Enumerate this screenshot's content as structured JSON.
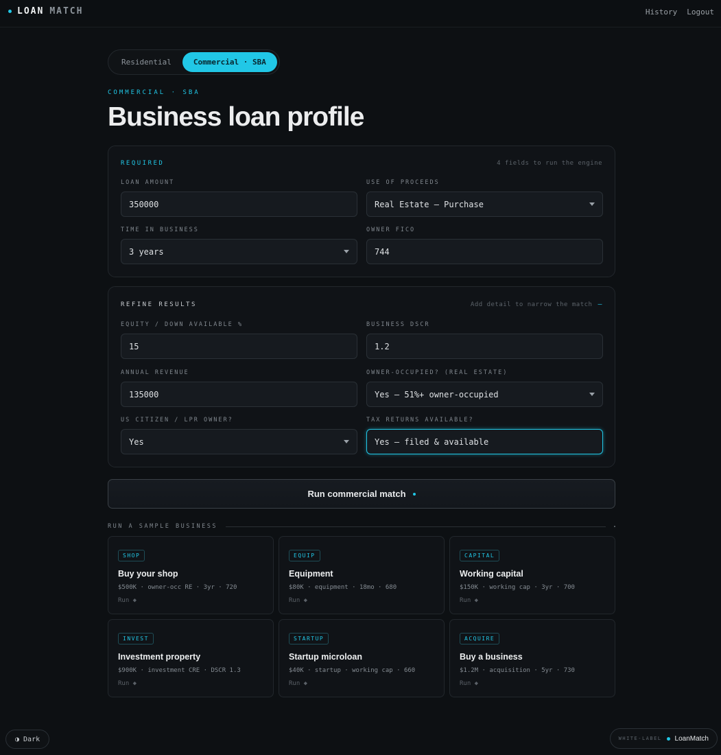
{
  "brand": {
    "loan": "LOAN",
    "match": "MATCH"
  },
  "nav": {
    "history": "History",
    "logout": "Logout"
  },
  "mode_toggle": {
    "residential": "Residential",
    "commercial": "Commercial · SBA"
  },
  "eyebrow": "COMMERCIAL · SBA",
  "title": "Business loan profile",
  "required": {
    "title": "REQUIRED",
    "hint": "4 fields to run the engine",
    "loan_amount": {
      "label": "LOAN AMOUNT",
      "value": "350000"
    },
    "use_of_proceeds": {
      "label": "USE OF PROCEEDS",
      "value": "Real Estate — Purchase"
    },
    "time_in_business": {
      "label": "TIME IN BUSINESS",
      "value": "3 years"
    },
    "owner_fico": {
      "label": "OWNER FICO",
      "value": "744"
    }
  },
  "refine": {
    "title": "REFINE RESULTS",
    "hint": "Add detail to narrow the match",
    "hint_icon": "–",
    "equity": {
      "label": "EQUITY / DOWN AVAILABLE %",
      "value": "15"
    },
    "dscr": {
      "label": "BUSINESS DSCR",
      "value": "1.2"
    },
    "annual_revenue": {
      "label": "ANNUAL REVENUE",
      "value": "135000"
    },
    "owner_occupied": {
      "label": "OWNER-OCCUPIED? (REAL ESTATE)",
      "value": "Yes — 51%+ owner-occupied"
    },
    "citizen": {
      "label": "US CITIZEN / LPR OWNER?",
      "value": "Yes"
    },
    "tax_returns": {
      "label": "TAX RETURNS AVAILABLE?",
      "value": "Yes — filed & available"
    }
  },
  "run_button": "Run commercial match",
  "samples_heading": "RUN A SAMPLE BUSINESS",
  "samples": [
    {
      "tag": "SHOP",
      "title": "Buy your shop",
      "meta": "$500K · owner-occ RE · 3yr · 720",
      "run": "Run ◆"
    },
    {
      "tag": "EQUIP",
      "title": "Equipment",
      "meta": "$80K · equipment · 18mo · 680",
      "run": "Run ◆"
    },
    {
      "tag": "CAPITAL",
      "title": "Working capital",
      "meta": "$150K · working cap · 3yr · 700",
      "run": "Run ◆"
    },
    {
      "tag": "INVEST",
      "title": "Investment property",
      "meta": "$900K · investment CRE · DSCR 1.3",
      "run": "Run ◆"
    },
    {
      "tag": "STARTUP",
      "title": "Startup microloan",
      "meta": "$40K · startup · working cap · 660",
      "run": "Run ◆"
    },
    {
      "tag": "ACQUIRE",
      "title": "Buy a business",
      "meta": "$1.2M · acquisition · 5yr · 730",
      "run": "Run ◆"
    }
  ],
  "theme_toggle": {
    "icon": "◑",
    "label": "Dark"
  },
  "white_label": {
    "label": "WHITE-LABEL",
    "name": "LoanMatch"
  },
  "colors": {
    "accent": "#21c7e6",
    "background": "#0d1013",
    "card": "#101317"
  }
}
